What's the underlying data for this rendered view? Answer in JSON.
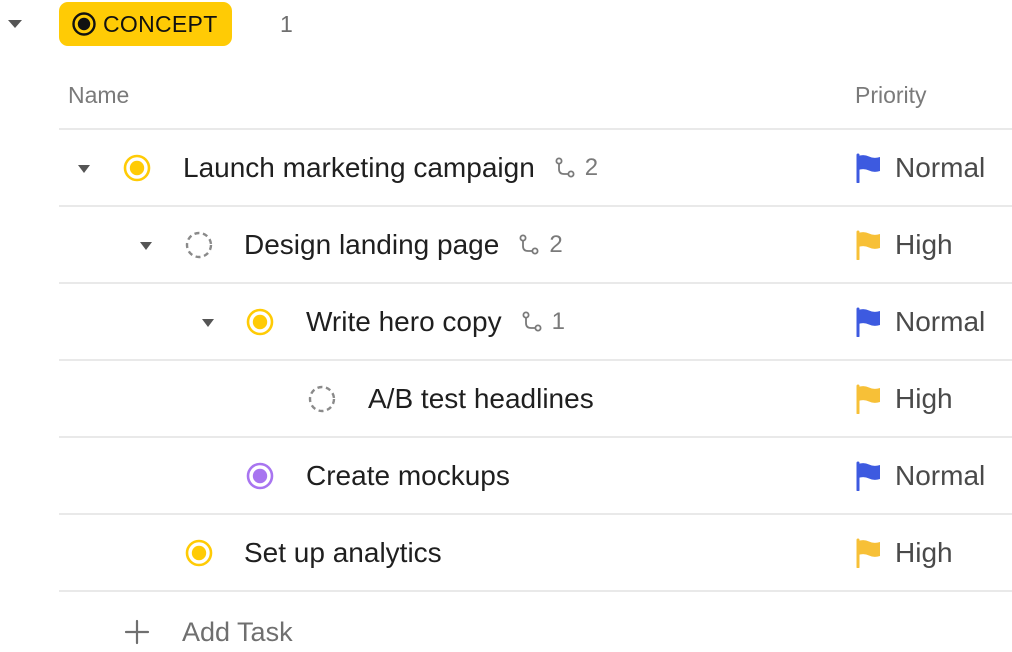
{
  "group": {
    "status_label": "CONCEPT",
    "count": "1",
    "pill_color": "#FFCB05"
  },
  "columns": {
    "name": "Name",
    "priority": "Priority"
  },
  "tasks": [
    {
      "name": "Launch marketing campaign",
      "subtasks": "2",
      "priority": "Normal",
      "status": "in-progress",
      "expanded": true
    },
    {
      "name": "Design landing page",
      "subtasks": "2",
      "priority": "High",
      "status": "todo",
      "expanded": true
    },
    {
      "name": "Write hero copy",
      "subtasks": "1",
      "priority": "Normal",
      "status": "in-progress",
      "expanded": true
    },
    {
      "name": "A/B test headlines",
      "priority": "High",
      "status": "todo"
    },
    {
      "name": "Create mockups",
      "priority": "Normal",
      "status": "review"
    },
    {
      "name": "Set up analytics",
      "priority": "High",
      "status": "in-progress"
    }
  ],
  "add_task": {
    "label": "Add Task"
  },
  "colors": {
    "in_progress": "#FFCB05",
    "review": "#A875F0",
    "todo": "#8a8a8a",
    "priority_normal": "#3D5AE0",
    "priority_high": "#F7C037"
  },
  "icons": {
    "group_toggle": "caret-down-icon",
    "subtasks": "subtask-branch-icon",
    "priority": "flag-icon",
    "add": "plus-icon"
  }
}
